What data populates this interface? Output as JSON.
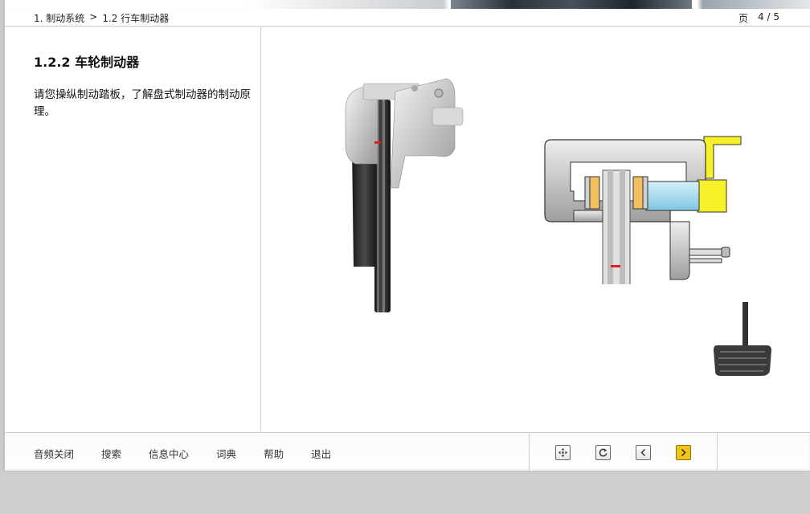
{
  "breadcrumb": {
    "level1": "1. 制动系统",
    "separator": ">",
    "level2": "1.2 行车制动器"
  },
  "page_indicator": {
    "label": "页",
    "value": "4 / 5"
  },
  "lesson": {
    "title": "1.2.2 车轮制动器",
    "text": "请您操纵制动踏板，了解盘式制动器的制动原理。"
  },
  "footer": {
    "menu": [
      "音频关闭",
      "搜索",
      "信息中心",
      "词典",
      "帮助",
      "退出"
    ]
  },
  "nav_icons": [
    "fullscreen-icon",
    "replay-icon",
    "previous-icon",
    "next-icon"
  ],
  "colors": {
    "accent": "#f2c318",
    "brake_fluid_yellow": "#f7f12a",
    "piston_blue": "#a9def0",
    "pad_orange": "#f2c060",
    "marker_red": "#e0201b"
  }
}
